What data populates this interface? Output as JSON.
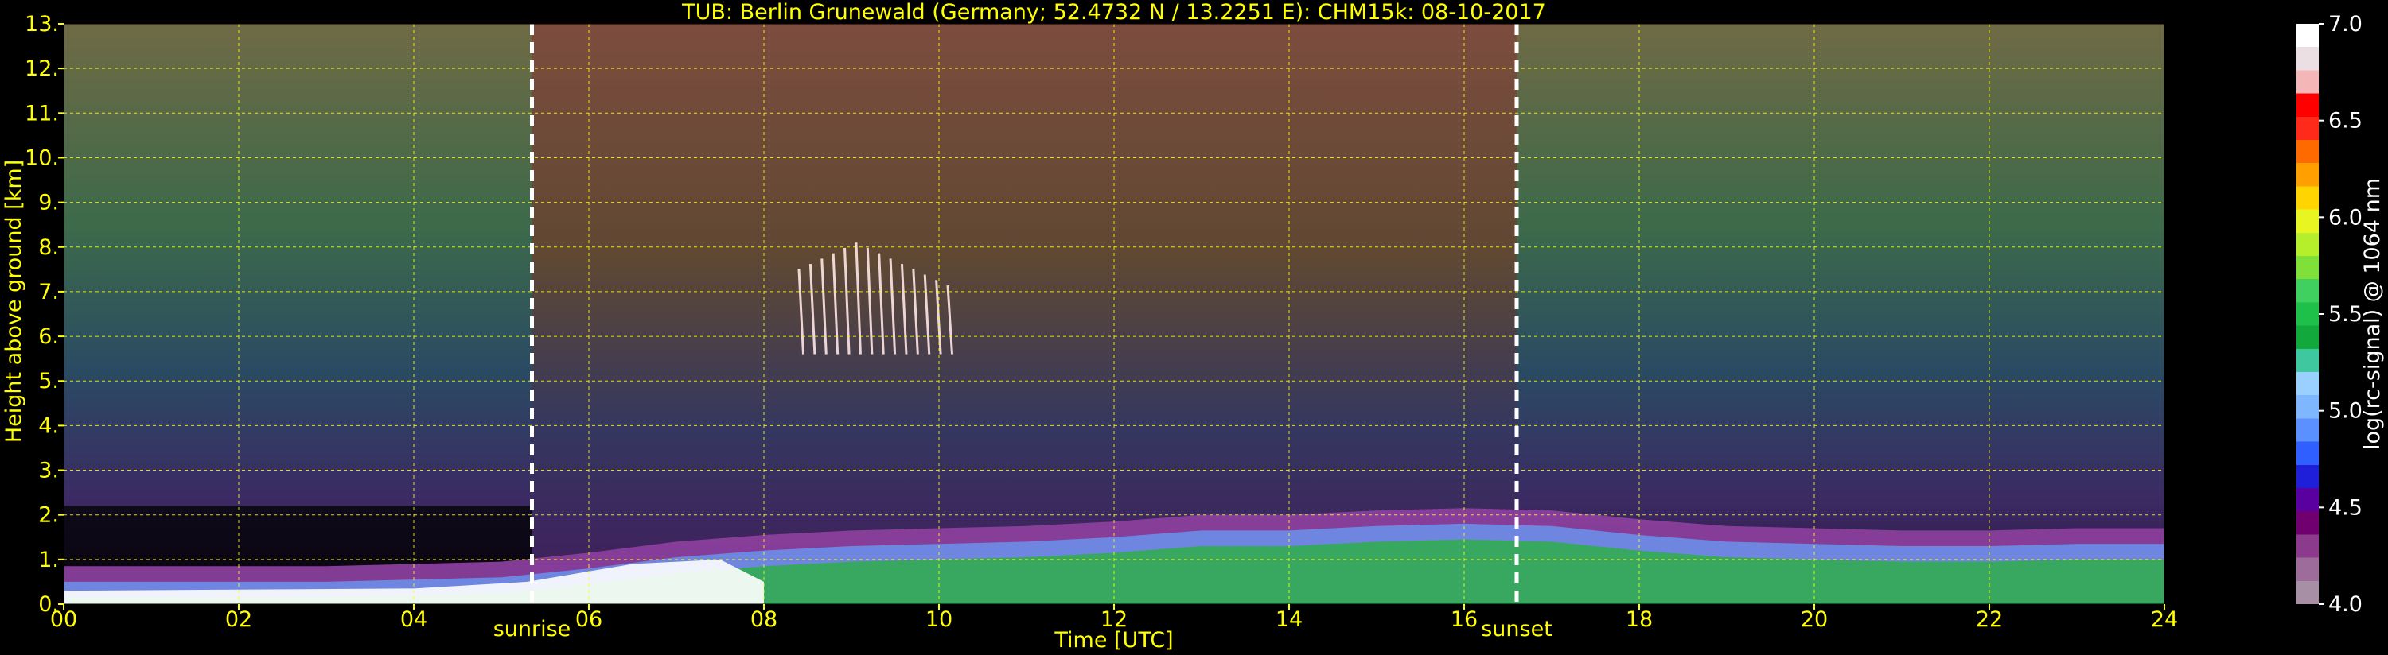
{
  "chart_data": {
    "type": "heatmap",
    "title": "TUB: Berlin Grunewald (Germany; 52.4732 N / 13.2251 E):    CHM15k: 08-10-2017",
    "xlabel": "Time [UTC]",
    "ylabel": "Height above ground [km]",
    "xlim": [
      0,
      24
    ],
    "ylim": [
      0,
      13
    ],
    "x_ticks": [
      "00",
      "02",
      "04",
      "06",
      "08",
      "10",
      "12",
      "14",
      "16",
      "18",
      "20",
      "22",
      "24"
    ],
    "x_tick_values": [
      0,
      2,
      4,
      6,
      8,
      10,
      12,
      14,
      16,
      18,
      20,
      22,
      24
    ],
    "y_ticks": [
      "0.",
      "1.",
      "2.",
      "3.",
      "4.",
      "5.",
      "6.",
      "7.",
      "8.",
      "9.",
      "10.",
      "11.",
      "12.",
      "13."
    ],
    "y_tick_values": [
      0,
      1,
      2,
      3,
      4,
      5,
      6,
      7,
      8,
      9,
      10,
      11,
      12,
      13
    ],
    "grid": true,
    "grid_color": "#ffff00",
    "text_color": "#ffff00",
    "markers": [
      {
        "label": "sunrise",
        "time": 5.35
      },
      {
        "label": "sunset",
        "time": 16.6
      }
    ],
    "colorbar": {
      "label": "log(rc-signal) @ 1064 nm",
      "min": 4.0,
      "max": 7.0,
      "ticks": [
        "4.0",
        "4.5",
        "5.0",
        "5.5",
        "6.0",
        "6.5",
        "7.0"
      ],
      "tick_values": [
        4.0,
        4.5,
        5.0,
        5.5,
        6.0,
        6.5,
        7.0
      ],
      "colors": [
        "#a78fa6",
        "#9e6c9a",
        "#8c3b8c",
        "#700070",
        "#5a00a0",
        "#1f1fd9",
        "#2f60ff",
        "#5a90ff",
        "#7fb7ff",
        "#9ad0ff",
        "#3fc7a0",
        "#12a83c",
        "#1fc04a",
        "#3fd060",
        "#7fe03a",
        "#b5ee2a",
        "#e8f520",
        "#ffd400",
        "#ffa000",
        "#ff6a00",
        "#ff2a1a",
        "#ff0000",
        "#f4b6b6",
        "#ecdfe4",
        "#ffffff"
      ]
    },
    "boundary_layer_top_km": [
      [
        0,
        0.5
      ],
      [
        1,
        0.5
      ],
      [
        2,
        0.5
      ],
      [
        3,
        0.5
      ],
      [
        4,
        0.55
      ],
      [
        5,
        0.6
      ],
      [
        6,
        0.8
      ],
      [
        7,
        1.05
      ],
      [
        8,
        1.2
      ],
      [
        9,
        1.3
      ],
      [
        10,
        1.35
      ],
      [
        11,
        1.4
      ],
      [
        12,
        1.5
      ],
      [
        13,
        1.65
      ],
      [
        14,
        1.65
      ],
      [
        15,
        1.75
      ],
      [
        16,
        1.8
      ],
      [
        17,
        1.75
      ],
      [
        18,
        1.55
      ],
      [
        19,
        1.4
      ],
      [
        20,
        1.35
      ],
      [
        21,
        1.3
      ],
      [
        22,
        1.3
      ],
      [
        23,
        1.35
      ],
      [
        24,
        1.35
      ]
    ],
    "cirrus_cloud": {
      "time_start": 8.4,
      "time_end": 10.1,
      "height_bottom_km": 5.6,
      "height_top_km": 8.1
    }
  }
}
